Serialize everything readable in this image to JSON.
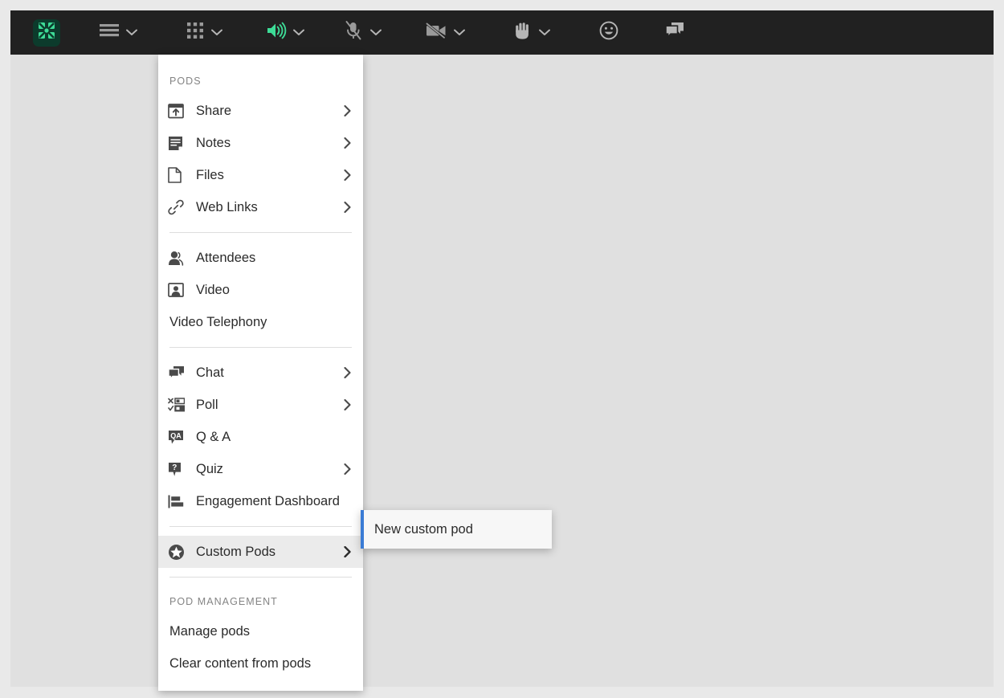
{
  "app": {
    "name": "Adobe Connect Meeting",
    "colors": {
      "toolbar_bg": "#212121",
      "stage_bg": "#e0e0e0",
      "page_bg": "#e9e9e9",
      "menu_bg": "#ffffff",
      "menu_highlight": "#ebebeb",
      "submenu_bg": "#f7f7f7",
      "submenu_accent": "#3a7bd5",
      "accent_green": "#3ddc97",
      "icon_gray": "#9a9a9a",
      "text_dark": "#2b2b2b",
      "section_label": "#848484"
    }
  },
  "toolbar": {
    "logo": {
      "name": "adobe-connect-logo",
      "label": "Adobe Connect"
    },
    "buttons": [
      {
        "id": "menu-bar",
        "icon": "hamburger-menu-icon",
        "label": "Meeting menu",
        "has_caret": true,
        "state": "inactive"
      },
      {
        "id": "pods",
        "icon": "grid-apps-icon",
        "label": "Pods",
        "has_caret": true,
        "state": "inactive"
      },
      {
        "id": "speaker",
        "icon": "speaker-on-icon",
        "label": "Speaker",
        "has_caret": true,
        "state": "active"
      },
      {
        "id": "microphone",
        "icon": "microphone-muted-icon",
        "label": "Microphone",
        "has_caret": true,
        "state": "muted"
      },
      {
        "id": "camera",
        "icon": "camera-muted-icon",
        "label": "Webcam",
        "has_caret": true,
        "state": "muted"
      },
      {
        "id": "raise-hand",
        "icon": "raised-hand-icon",
        "label": "Raise hand",
        "has_caret": true,
        "state": "inactive"
      },
      {
        "id": "status",
        "icon": "smiley-face-icon",
        "label": "Status / reactions",
        "has_caret": false,
        "state": "inactive"
      },
      {
        "id": "chat",
        "icon": "chat-bubbles-icon",
        "label": "Chat",
        "has_caret": false,
        "state": "inactive"
      }
    ]
  },
  "pods_menu": {
    "section_pods_label": "PODS",
    "section_management_label": "POD MANAGEMENT",
    "items": [
      {
        "label": "Share",
        "icon": "share-screen-icon",
        "arrow": true,
        "highlight": false
      },
      {
        "label": "Notes",
        "icon": "notes-icon",
        "arrow": true,
        "highlight": false
      },
      {
        "label": "Files",
        "icon": "file-document-icon",
        "arrow": true,
        "highlight": false
      },
      {
        "label": "Web Links",
        "icon": "link-chain-icon",
        "arrow": true,
        "highlight": false
      },
      {
        "label": "Attendees",
        "icon": "attendees-person-icon",
        "arrow": false,
        "highlight": false
      },
      {
        "label": "Video",
        "icon": "video-portrait-icon",
        "arrow": false,
        "highlight": false
      },
      {
        "label": "Video Telephony",
        "icon": "none",
        "arrow": false,
        "highlight": false
      },
      {
        "label": "Chat",
        "icon": "chat-bubbles-icon",
        "arrow": true,
        "highlight": false
      },
      {
        "label": "Poll",
        "icon": "poll-checklist-icon",
        "arrow": true,
        "highlight": false
      },
      {
        "label": "Q & A",
        "icon": "qa-bubble-icon",
        "arrow": false,
        "highlight": false
      },
      {
        "label": "Quiz",
        "icon": "quiz-question-icon",
        "arrow": true,
        "highlight": false
      },
      {
        "label": "Engagement Dashboard",
        "icon": "engagement-barchart-icon",
        "arrow": false,
        "highlight": false
      },
      {
        "label": "Custom Pods",
        "icon": "star-badge-icon",
        "arrow": true,
        "highlight": true
      }
    ],
    "management_items": [
      {
        "label": "Manage pods"
      },
      {
        "label": "Clear content from pods"
      }
    ]
  },
  "custom_pods_submenu": {
    "items": [
      {
        "label": "New custom pod"
      }
    ]
  }
}
